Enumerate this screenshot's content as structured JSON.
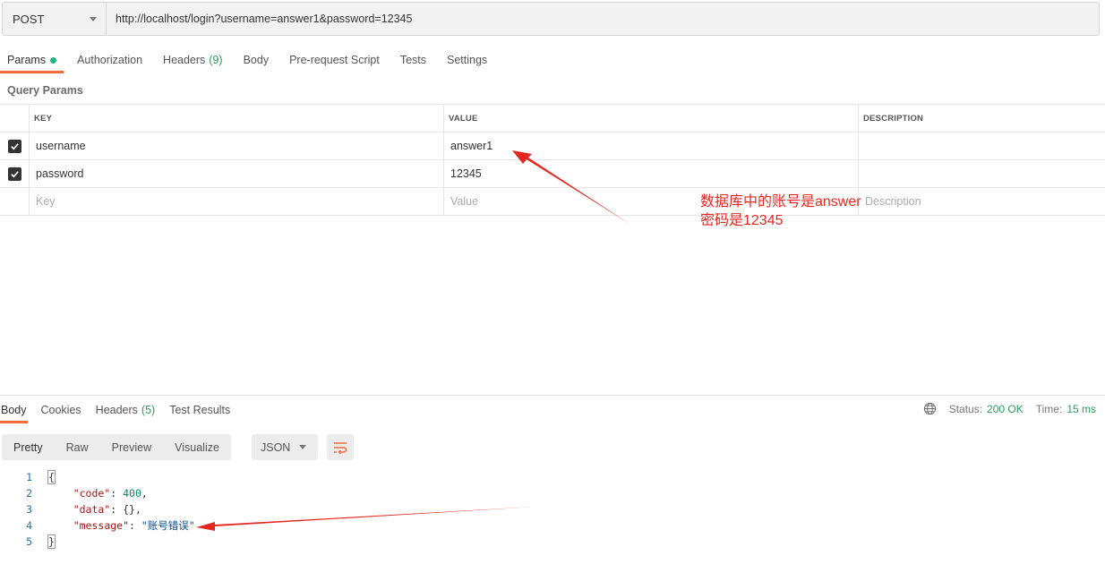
{
  "request": {
    "method": "POST",
    "url": "http://localhost/login?username=answer1&password=12345"
  },
  "tabs": [
    {
      "label": "Params",
      "active": true,
      "has_dot": true
    },
    {
      "label": "Authorization"
    },
    {
      "label": "Headers",
      "count": "(9)"
    },
    {
      "label": "Body"
    },
    {
      "label": "Pre-request Script"
    },
    {
      "label": "Tests"
    },
    {
      "label": "Settings"
    }
  ],
  "query_params": {
    "title": "Query Params",
    "headers": {
      "key": "KEY",
      "value": "VALUE",
      "description": "DESCRIPTION"
    },
    "rows": [
      {
        "key": "username",
        "value": "answer1",
        "checked": true
      },
      {
        "key": "password",
        "value": "12345",
        "checked": true
      }
    ],
    "placeholders": {
      "key": "Key",
      "value": "Value",
      "description": "Description"
    }
  },
  "annotation": {
    "line1": "数据库中的账号是answer",
    "line2": "密码是12345",
    "color": "#e5281f"
  },
  "response": {
    "tabs": [
      {
        "label": "Body",
        "active": true
      },
      {
        "label": "Cookies"
      },
      {
        "label": "Headers",
        "count": "(5)"
      },
      {
        "label": "Test Results"
      }
    ],
    "status_label": "Status:",
    "status_value": "200 OK",
    "time_label": "Time:",
    "time_value": "15 ms",
    "view_modes": [
      "Pretty",
      "Raw",
      "Preview",
      "Visualize"
    ],
    "format": "JSON",
    "code_lines": {
      "line_numbers": [
        "1",
        "2",
        "3",
        "4",
        "5"
      ],
      "open": "{",
      "code_key": "\"code\"",
      "code_val": "400",
      "data_key": "\"data\"",
      "data_val": "{}",
      "message_key": "\"message\"",
      "message_val": "\"账号错误\"",
      "close": "}"
    }
  },
  "colors": {
    "accent": "#f26b3a",
    "success": "#2a9d5c",
    "arrow": "#e5281f"
  }
}
